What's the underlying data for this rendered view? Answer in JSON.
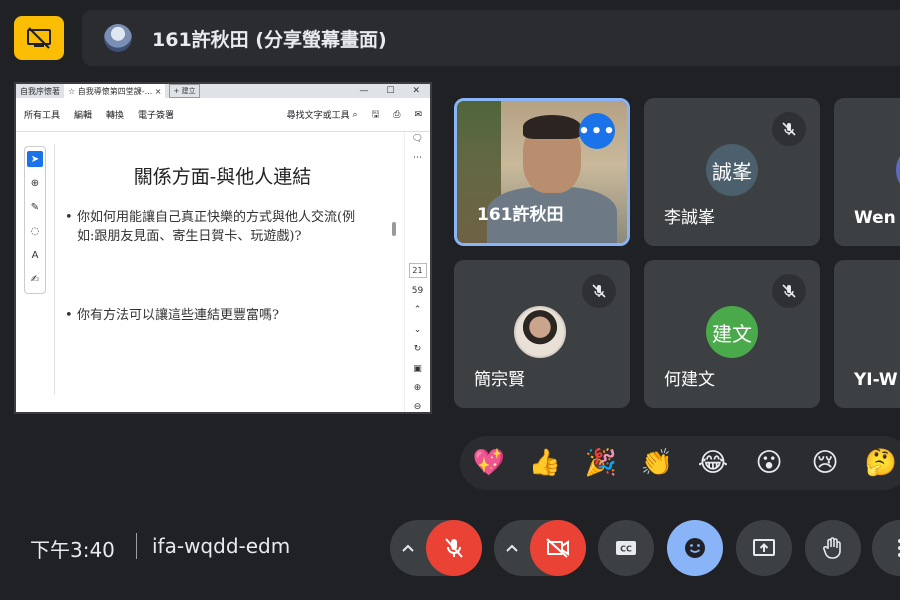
{
  "top": {
    "presenter_label": "161許秋田 (分享螢幕畫面)"
  },
  "screen": {
    "tabs": [
      "自我序懷著",
      "自我導懷第四堂課-...",
      "建立"
    ],
    "menu": [
      "所有工具",
      "編輯",
      "轉換",
      "電子簽署"
    ],
    "find_label": "尋找文字或工具",
    "slide_title": "關係方面-與他人連結",
    "bullet_1": "你如何用能讓自己真正快樂的方式與他人交流(例如:跟朋友見面、寄生日賀卡、玩遊戲)?",
    "bullet_2": "你有方法可以讓這些連結更豐富嗎?",
    "page_current": "21",
    "page_total": "59"
  },
  "tiles": {
    "presenter_name": "161許秋田",
    "t2_name": "李誠峯",
    "t2_initials": "誠峯",
    "t3_name": "Wen",
    "t4_name": "簡宗賢",
    "t5_name": "何建文",
    "t5_initials": "建文",
    "t6_name": "YI-W",
    "avatar_colors": {
      "chengfeng": "#4b5f6d",
      "jianwen": "#4aa94a"
    }
  },
  "reactions": [
    "💖",
    "👍",
    "🎉",
    "👏",
    "😂",
    "😮",
    "😢",
    "🤔"
  ],
  "bottom": {
    "time": "下午3:40",
    "meeting_code": "ifa-wqdd-edm"
  },
  "colors": {
    "accent_yellow": "#fbbc04",
    "accent_red": "#ea4335",
    "accent_blue": "#8ab4f8"
  }
}
